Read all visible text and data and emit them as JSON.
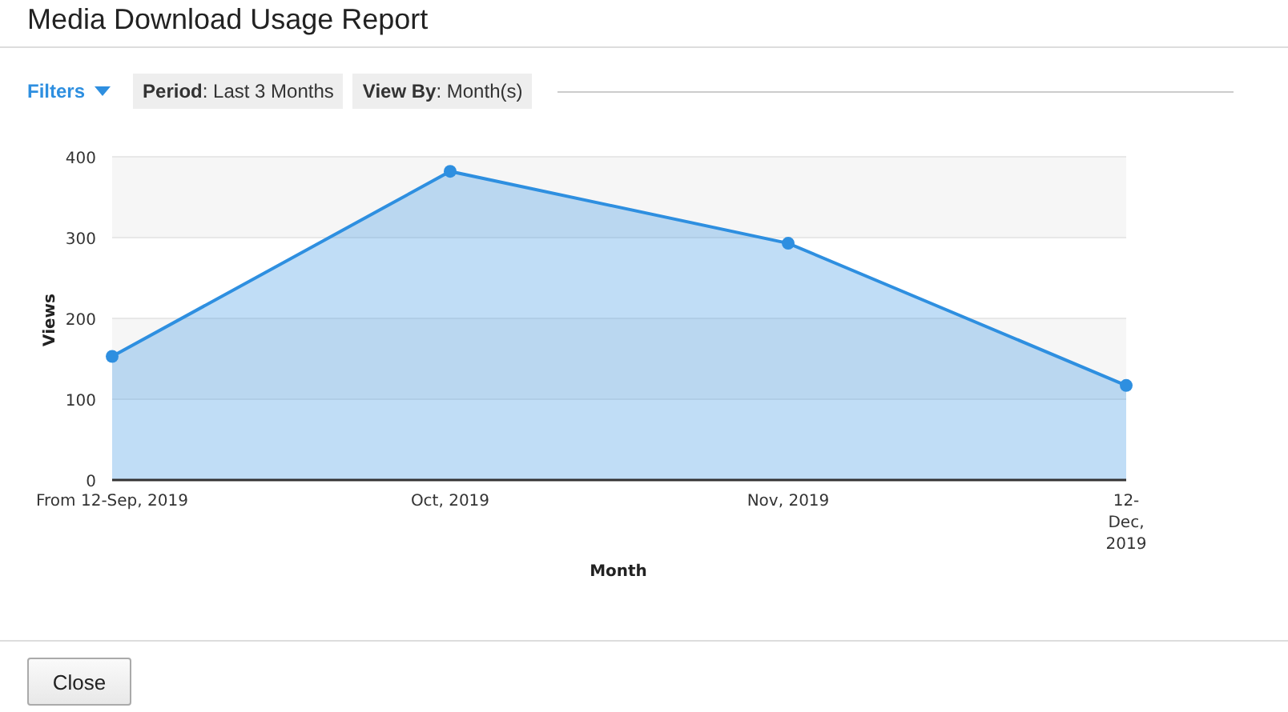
{
  "window": {
    "title": "Media Download Usage Report"
  },
  "filters": {
    "label": "Filters",
    "chips": [
      {
        "text": "**Period**: Last 3 Months"
      },
      {
        "text": "**View By**: Month(s)"
      }
    ]
  },
  "chart_data": {
    "type": "area",
    "xlabel": "Month",
    "ylabel": "Views",
    "categories": [
      "From 12-Sep, 2019",
      "Oct, 2019",
      "Nov, 2019",
      "12-Dec, 2019"
    ],
    "grid": true,
    "series": [
      {
        "color": "#2e8fe0",
        "values": [
          153,
          382,
          293,
          117
        ]
      }
    ],
    "ylim": [
      0,
      400
    ],
    "yticks": [
      0,
      100,
      200,
      300,
      400
    ]
  },
  "buttons": [
    {
      "label": "Close"
    }
  ]
}
